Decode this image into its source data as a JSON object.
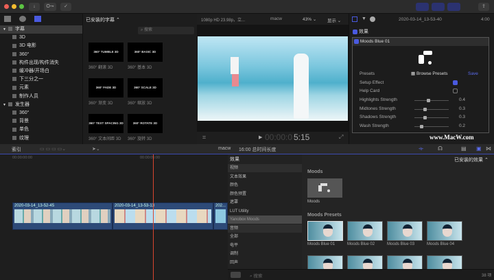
{
  "toolbar": {
    "buttons": [
      "↓",
      "O⊸",
      "✓"
    ]
  },
  "sidebar": {
    "items": [
      {
        "label": "字幕",
        "level": 0,
        "selected": true
      },
      {
        "label": "3D",
        "level": 1
      },
      {
        "label": "3D 电影",
        "level": 1
      },
      {
        "label": "360°",
        "level": 1
      },
      {
        "label": "构件出现/构件消失",
        "level": 1
      },
      {
        "label": "缓冲器/开场白",
        "level": 1
      },
      {
        "label": "下三分之一",
        "level": 1
      },
      {
        "label": "元素",
        "level": 1
      },
      {
        "label": "制作人员",
        "level": 1
      },
      {
        "label": "发生器",
        "level": 0
      },
      {
        "label": "360°",
        "level": 1
      },
      {
        "label": "背景",
        "level": 1
      },
      {
        "label": "单色",
        "level": 1
      },
      {
        "label": "纹理",
        "level": 1
      }
    ]
  },
  "browser": {
    "title": "已安装的字幕 ⌃",
    "search_placeholder": "搜索",
    "items": [
      {
        "thumb": "360° TUMBLE 3D",
        "caption": "360° 翻滚 3D"
      },
      {
        "thumb": "360° BASIC 3D",
        "caption": "360° 基本 3D"
      },
      {
        "thumb": "360° FADE 3D",
        "caption": "360° 渐变 3D"
      },
      {
        "thumb": "360° SCALE 3D",
        "caption": "360° 缩放 3D"
      },
      {
        "thumb": "360° TEXT SPACING 3D",
        "caption": "360° 文本间距 3D"
      },
      {
        "thumb": "360° ROTATE 3D",
        "caption": "360° 旋转 3D"
      }
    ]
  },
  "viewer": {
    "format": "1080p HD 23.98p，立...",
    "project": "macw",
    "zoom": "43% ⌄",
    "display": "显示 ⌄",
    "timecode_dim": "00:00:0",
    "timecode": "5:15"
  },
  "inspector": {
    "clip_name": "2020-03-14_13-53-40",
    "duration": "4:00",
    "effects_label": "效果",
    "effect_name": "Moods Blue 01",
    "presets_label": "Presets",
    "browse_presets": "Browse Presets",
    "save": "Save",
    "setup_effect": "Setup Effect",
    "help_card": "Help Card",
    "params": [
      {
        "label": "Highlights Strength",
        "value": "0.4",
        "fraction": 0.4
      },
      {
        "label": "Midtones Strength",
        "value": "0.3",
        "fraction": 0.3
      },
      {
        "label": "Shadows Strength",
        "value": "0.3",
        "fraction": 0.3
      },
      {
        "label": "Wash Strength",
        "value": "0.2",
        "fraction": 0.2
      }
    ]
  },
  "watermark": "www.MacW.com",
  "timeline": {
    "index_label": "索引",
    "project": "macw",
    "duration": "16:00 总时间长度",
    "ruler": [
      "00:00:00:00",
      "00:00:05:00"
    ],
    "clips": [
      {
        "label": "2020-03-14_13-52-45"
      },
      {
        "label": "2020-03-14_13-53-13"
      },
      {
        "label": "202..."
      }
    ]
  },
  "effects": {
    "header": "效果",
    "categories": [
      "视频",
      "文本效果",
      "颜色",
      "颜色预置",
      "遮罩",
      "LUT Utility",
      "Yanobox Moods",
      "音频",
      "全部",
      "电平",
      "调制",
      "回声"
    ],
    "selected": "Yanobox Moods",
    "installed": "已安装的效果 ⌃",
    "section1": "Moods",
    "item1": "Moods",
    "section2": "Moods Presets",
    "presets": [
      "Moods Blue 01",
      "Moods Blue 02",
      "Moods Blue 03",
      "Moods Blue 04"
    ],
    "search_placeholder": "搜索",
    "count": "38 项"
  }
}
